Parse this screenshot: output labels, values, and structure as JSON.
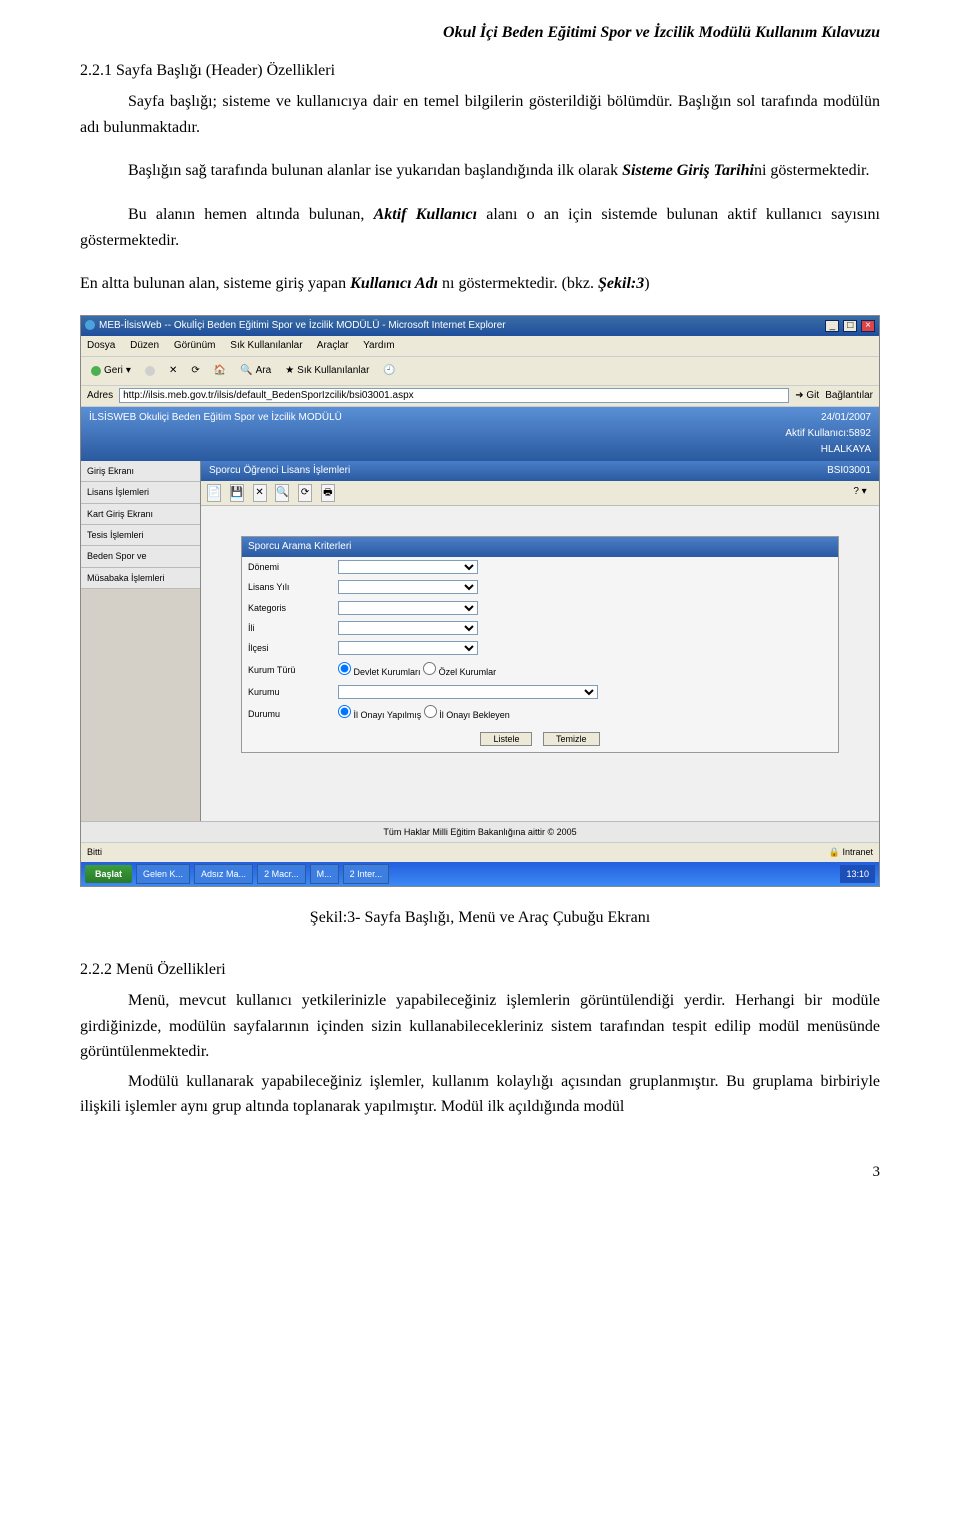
{
  "doc_title": "Okul İçi Beden Eğitimi Spor ve İzcilik Modülü Kullanım Kılavuzu",
  "sections": {
    "s221_heading": "2.2.1 Sayfa Başlığı (Header) Özellikleri",
    "p1a": "Sayfa başlığı; sisteme ve kullanıcıya dair en temel bilgilerin gösterildiği bölümdür. Başlığın sol tarafında modülün adı bulunmaktadır.",
    "p2_pre": "Başlığın sağ tarafında bulunan alanlar ise yukarıdan başlandığında ilk olarak ",
    "p2_em": "Sisteme Giriş Tarihi",
    "p2_post": "ni göstermektedir.",
    "p3_pre": "Bu alanın hemen altında bulunan, ",
    "p3_em": "Aktif Kullanıcı",
    "p3_post": " alanı o an için sistemde bulunan aktif kullanıcı sayısını göstermektedir.",
    "p4_pre": "En altta bulunan alan, sisteme giriş yapan ",
    "p4_em": "Kullanıcı Adı",
    "p4_post": " nı göstermektedir. (bkz. ",
    "p4_ref": "Şekil:3",
    "caption": "Şekil:3- Sayfa Başlığı, Menü ve Araç Çubuğu Ekranı",
    "s222_heading": "2.2.2 Menü Özellikleri",
    "p5": "Menü, mevcut kullanıcı yetkilerinizle yapabileceğiniz işlemlerin görüntülendiği yerdir. Herhangi bir modüle girdiğinizde, modülün sayfalarının içinden sizin kullanabilecekleriniz sistem tarafından tespit edilip modül menüsünde görüntülenmektedir.",
    "p6": "Modülü kullanarak yapabileceğiniz işlemler, kullanım kolaylığı açısından gruplanmıştır. Bu gruplama birbiriyle ilişkili işlemler aynı grup altında toplanarak yapılmıştır. Modül ilk açıldığında modül"
  },
  "page_number": "3",
  "screenshot": {
    "ie_title": "MEB-İlsisWeb -- Okulİçi Beden Eğitimi Spor ve İzcilik MODÜLÜ - Microsoft Internet Explorer",
    "menu": [
      "Dosya",
      "Düzen",
      "Görünüm",
      "Sık Kullanılanlar",
      "Araçlar",
      "Yardım"
    ],
    "toolbar": {
      "back": "Geri",
      "search": "Ara",
      "favs": "Sık Kullanılanlar"
    },
    "address_label": "Adres",
    "address": "http://ilsis.meb.gov.tr/ilsis/default_BedenSporİzcilik/bsi03001.aspx",
    "go": "Git",
    "links": "Bağlantılar",
    "app_header_left": "İLSİSWEB   Okuliçi Beden Eğitim Spor ve İzcilik MODÜLÜ",
    "app_header_date": "24/01/2007",
    "app_header_users": "Aktif Kullanıcı:5892",
    "app_header_user": "HLALKAYA",
    "sidebar": [
      "Giriş Ekranı",
      "Lisans İşlemleri",
      "Kart Giriş Ekranı",
      "Tesis İşlemleri",
      "Beden Spor ve",
      "Müsabaka İşlemleri"
    ],
    "main_title": "Sporcu Öğrenci Lisans İşlemleri",
    "main_code": "BSI03001",
    "search_criteria_title": "Sporcu Arama Kriterleri",
    "fields": {
      "donem": "Dönemi",
      "lisans_yili": "Lisans Yılı",
      "kategoris": "Kategoris",
      "ili": "İli",
      "ilcesi": "İlçesi",
      "kurum_turu": "Kurum Türü",
      "kurum_devlet": "Devlet Kurumları",
      "kurum_ozel": "Özel Kurumlar",
      "kurumu": "Kurumu",
      "durumu": "Durumu",
      "onay_yapilmis": "İl Onayı Yapılmış",
      "onay_bekleyen": "İl Onayı Bekleyen",
      "listele": "Listele",
      "temizle": "Temizle"
    },
    "footer": "Tüm Haklar Milli Eğitim Bakanlığına aittir © 2005",
    "status_done": "Bitti",
    "status_intranet": "Intranet",
    "taskbar": {
      "start": "Başlat",
      "tasks": [
        "Gelen K...",
        "Adsız Ma...",
        "2 Macr...",
        "M...",
        "2 Inter..."
      ],
      "tray_time": "13:10"
    }
  }
}
